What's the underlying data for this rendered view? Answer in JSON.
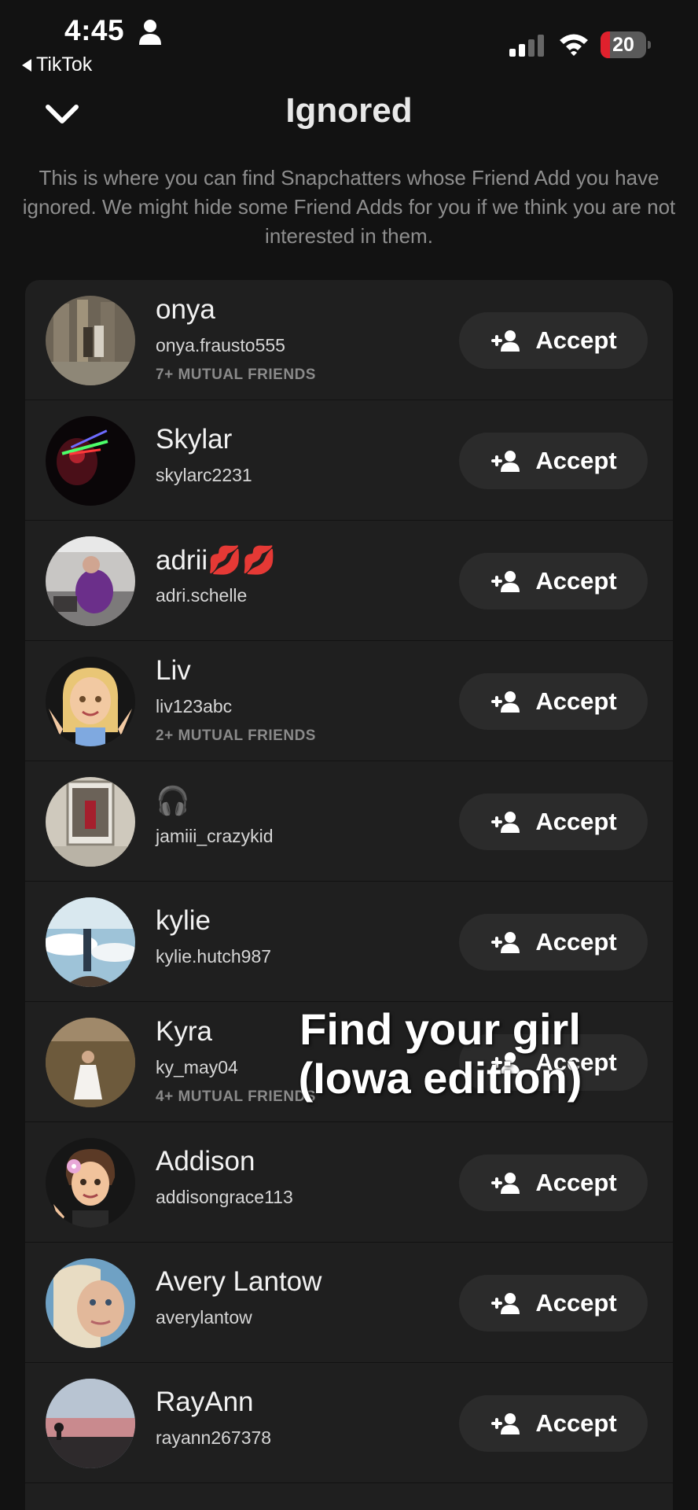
{
  "status_bar": {
    "time": "4:45",
    "back_app": "TikTok",
    "battery": "20",
    "battery_level": 0.2
  },
  "header": {
    "title": "Ignored"
  },
  "description": "This is where you can find Snapchatters whose Friend Add you have ignored. We might hide some Friend Adds for you if we think you are not interested in them.",
  "accept_label": "Accept",
  "rows": [
    {
      "name": "onya",
      "username": "onya.frausto555",
      "mutual": "7+ MUTUAL FRIENDS"
    },
    {
      "name": "Skylar",
      "username": "skylarc2231",
      "mutual": ""
    },
    {
      "name": "adrii💋💋",
      "username": "adri.schelle",
      "mutual": ""
    },
    {
      "name": "Liv",
      "username": "liv123abc",
      "mutual": "2+ MUTUAL FRIENDS"
    },
    {
      "name": "🎧",
      "username": "jamiii_crazykid",
      "mutual": ""
    },
    {
      "name": "kylie",
      "username": "kylie.hutch987",
      "mutual": ""
    },
    {
      "name": "Kyra",
      "username": "ky_may04",
      "mutual": "4+ MUTUAL FRIENDS"
    },
    {
      "name": "Addison",
      "username": "addisongrace113",
      "mutual": ""
    },
    {
      "name": "Avery Lantow",
      "username": "averylantow",
      "mutual": ""
    },
    {
      "name": "RayAnn",
      "username": "rayann267378",
      "mutual": ""
    }
  ],
  "overlay": {
    "line1": "Find your girl",
    "line2": "(Iowa edition)"
  },
  "colors": {
    "background": "#121212",
    "card": "#1f1f1f",
    "button": "#2b2b2b",
    "muted": "#8e8e8e",
    "battery_red": "#e0212d"
  }
}
